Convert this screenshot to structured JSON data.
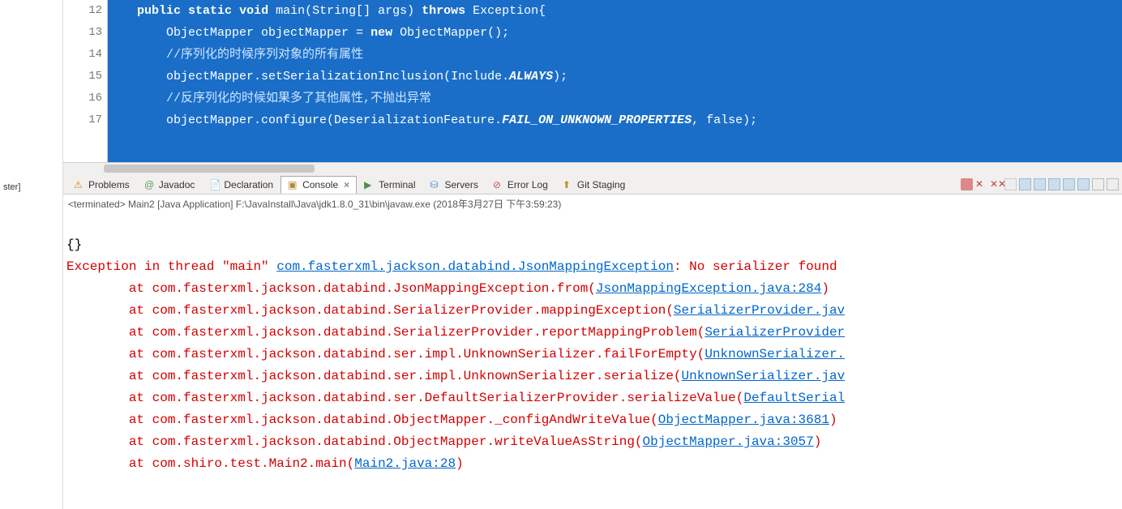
{
  "left_gutter_text": "ster]",
  "editor": {
    "lines": [
      {
        "no": "12",
        "indent": "    ",
        "tokens": [
          {
            "t": "public",
            "c": "kw"
          },
          {
            "t": " "
          },
          {
            "t": "static",
            "c": "kw"
          },
          {
            "t": " "
          },
          {
            "t": "void",
            "c": "kw"
          },
          {
            "t": " main(String[] args) "
          },
          {
            "t": "throws",
            "c": "kw"
          },
          {
            "t": " Exception{"
          }
        ]
      },
      {
        "no": "13",
        "indent": "        ",
        "tokens": [
          {
            "t": "ObjectMapper objectMapper = "
          },
          {
            "t": "new",
            "c": "kw"
          },
          {
            "t": " ObjectMapper();"
          }
        ]
      },
      {
        "no": "14",
        "indent": "        ",
        "tokens": [
          {
            "t": "//序列化的时候序列对象的所有属性",
            "c": "comment"
          }
        ]
      },
      {
        "no": "15",
        "indent": "        ",
        "tokens": [
          {
            "t": "objectMapper.setSerializationInclusion(Include."
          },
          {
            "t": "ALWAYS",
            "c": "it"
          },
          {
            "t": ");"
          }
        ]
      },
      {
        "no": "16",
        "indent": "        ",
        "tokens": [
          {
            "t": "//反序列化的时候如果多了其他属性,不抛出异常",
            "c": "comment"
          }
        ]
      },
      {
        "no": "17",
        "indent": "        ",
        "tokens": [
          {
            "t": "objectMapper.configure(DeserializationFeature."
          },
          {
            "t": "FAIL_ON_UNKNOWN_PROPERTIES",
            "c": "it"
          },
          {
            "t": ", false);"
          }
        ]
      }
    ]
  },
  "tabs": {
    "problems": "Problems",
    "javadoc": "Javadoc",
    "declaration": "Declaration",
    "console": "Console",
    "terminal": "Terminal",
    "servers": "Servers",
    "errorlog": "Error Log",
    "gitstaging": "Git Staging"
  },
  "console_status": "<terminated> Main2 [Java Application] F:\\JavaInstall\\Java\\jdk1.8.0_31\\bin\\javaw.exe (2018年3月27日 下午3:59:23)",
  "console": {
    "line0": "{}",
    "l1a": "Exception in thread \"main\" ",
    "l1b": "com.fasterxml.jackson.databind.JsonMappingException",
    "l1c": ": No serializer found ",
    "l2a": "\tat com.fasterxml.jackson.databind.JsonMappingException.from(",
    "l2b": "JsonMappingException.java:284",
    "l2c": ")",
    "l3a": "\tat com.fasterxml.jackson.databind.SerializerProvider.mappingException(",
    "l3b": "SerializerProvider.jav",
    "l4a": "\tat com.fasterxml.jackson.databind.SerializerProvider.reportMappingProblem(",
    "l4b": "SerializerProvider",
    "l5a": "\tat com.fasterxml.jackson.databind.ser.impl.UnknownSerializer.failForEmpty(",
    "l5b": "UnknownSerializer.",
    "l6a": "\tat com.fasterxml.jackson.databind.ser.impl.UnknownSerializer.serialize(",
    "l6b": "UnknownSerializer.jav",
    "l7a": "\tat com.fasterxml.jackson.databind.ser.DefaultSerializerProvider.serializeValue(",
    "l7b": "DefaultSerial",
    "l8a": "\tat com.fasterxml.jackson.databind.ObjectMapper._configAndWriteValue(",
    "l8b": "ObjectMapper.java:3681",
    "l8c": ")",
    "l9a": "\tat com.fasterxml.jackson.databind.ObjectMapper.writeValueAsString(",
    "l9b": "ObjectMapper.java:3057",
    "l9c": ")",
    "l10a": "\tat com.shiro.test.Main2.main(",
    "l10b": "Main2.java:28",
    "l10c": ")"
  },
  "icons": {
    "problems": "⚠",
    "javadoc": "@",
    "declaration": "📄",
    "console": "▣",
    "terminal": "▶",
    "servers": "⛁",
    "errorlog": "⊘",
    "gitstaging": "⬆"
  }
}
